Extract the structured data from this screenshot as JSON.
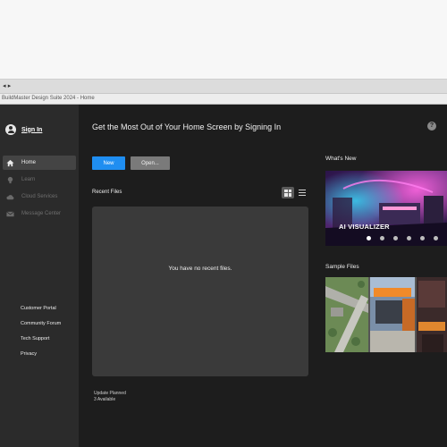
{
  "window": {
    "title": "BuildMaster Design Suite 2024 - Home",
    "tab_nav": "◂ ▸"
  },
  "sidebar": {
    "sign_in": "Sign In",
    "items": [
      {
        "label": "Home",
        "icon": "home-icon",
        "active": true
      },
      {
        "label": "Learn",
        "icon": "lightbulb-icon",
        "active": false
      },
      {
        "label": "Cloud Services",
        "icon": "cloud-icon",
        "active": false
      },
      {
        "label": "Message Center",
        "icon": "envelope-icon",
        "active": false
      }
    ],
    "links": [
      "Customer Portal",
      "Community Forum",
      "Tech Support",
      "Privacy"
    ]
  },
  "main": {
    "headline": "Get the Most Out of Your Home Screen by Signing In",
    "new_button": "New",
    "open_button": "Open...",
    "recent_files_title": "Recent Files",
    "empty_message": "You have no recent files.",
    "footer_line1": "Update Planned",
    "footer_line2": "3 Available",
    "whats_new_title": "What's New",
    "whats_new_caption": "AI VISUALIZER",
    "carousel": {
      "count": 6,
      "active_index": 0
    },
    "sample_files_title": "Sample Files"
  },
  "colors": {
    "accent": "#1f8ef1",
    "sidebar_bg": "#2b2b2b",
    "main_bg": "#1d1d1d",
    "panel_bg": "#3a3a3a"
  }
}
